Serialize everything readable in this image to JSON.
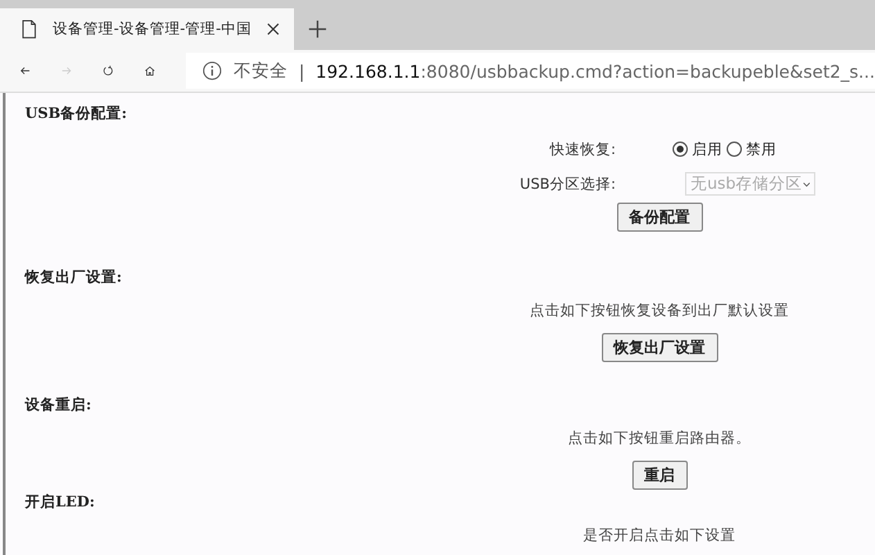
{
  "browser": {
    "tab_title": "设备管理-设备管理-管理-中国",
    "address": {
      "security": "不安全",
      "separator": "|",
      "host": "192.168.1.1",
      "rest": ":8080/usbbackup.cmd?action=backupeble&set2_s..."
    }
  },
  "sections": [
    {
      "kind": "form",
      "heading": "USB备份配置:",
      "fields": [
        {
          "kind": "radio",
          "label": "快速恢复:",
          "options": [
            {
              "label": "启用",
              "selected": true
            },
            {
              "label": "禁用",
              "selected": false
            }
          ]
        },
        {
          "kind": "select",
          "label": "USB分区选择:",
          "value": "无usb存储分区",
          "disabled": true
        }
      ],
      "button": "备份配置"
    },
    {
      "kind": "action",
      "heading": "恢复出厂设置:",
      "note": "点击如下按钮恢复设备到出厂默认设置",
      "button": "恢复出厂设置"
    },
    {
      "kind": "action",
      "heading": "设备重启:",
      "note": "点击如下按钮重启路由器。",
      "button": "重启"
    },
    {
      "kind": "action",
      "heading": "开启LED:",
      "note": "是否开启点击如下设置"
    }
  ]
}
